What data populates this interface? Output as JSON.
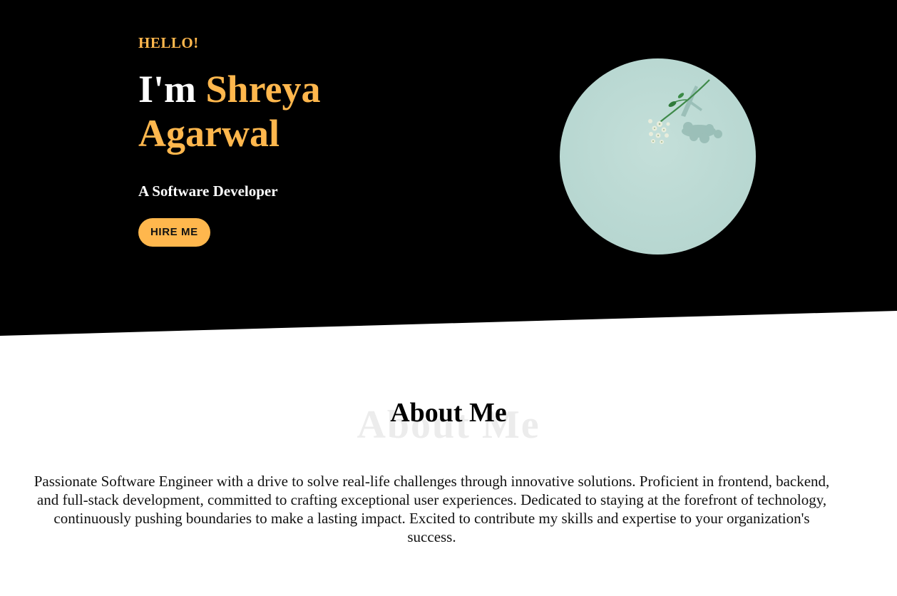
{
  "hero": {
    "greeting": "HELLO!",
    "name_prefix": "I'm ",
    "name": "Shreya Agarwal",
    "subtitle": "A Software Developer",
    "cta_label": "HIRE ME",
    "photo_icon": "flower-photo-icon"
  },
  "about": {
    "title": "About Me",
    "title_shadow": "About Me",
    "description": "Passionate Software Engineer with a drive to solve real-life challenges through innovative solutions. Proficient in frontend, backend, and full-stack development, committed to crafting exceptional user experiences. Dedicated to staying at the forefront of technology, continuously pushing boundaries to make a lasting impact. Excited to contribute my skills and expertise to your organization's success."
  },
  "colors": {
    "accent": "#ffb74d",
    "hero_background": "#000000",
    "photo_background": "#b9d8d2"
  }
}
